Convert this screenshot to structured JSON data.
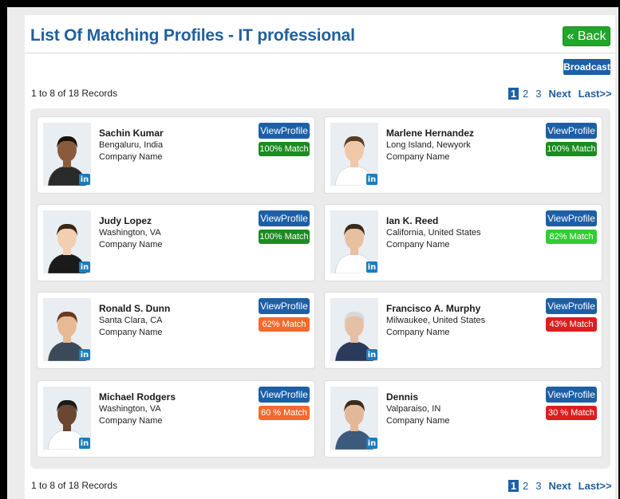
{
  "header": {
    "title": "List Of Matching Profiles - IT professional",
    "back_label": "« Back",
    "broadcast_label": "Broadcast"
  },
  "records_text": "1 to 8 of 18 Records",
  "pagination": {
    "pages": [
      "1",
      "2",
      "3"
    ],
    "next": "Next",
    "last": "Last>>"
  },
  "linkedin_badge": "in",
  "colors": {
    "green_dark": "#1e8a23",
    "green_light": "#33cc33",
    "orange": "#f26a2e",
    "red": "#d91f1f",
    "blue": "#1c5fa6"
  },
  "profiles": [
    {
      "name": "Sachin Kumar",
      "location": "Bengaluru, India",
      "company": "Company Name",
      "view_label": "ViewProfile",
      "match": "100% Match",
      "match_color": "#1e8a23"
    },
    {
      "name": "Marlene Hernandez",
      "location": "Long Island, Newyork",
      "company": "Company Name",
      "view_label": "ViewProfile",
      "match": "100% Match",
      "match_color": "#1e8a23"
    },
    {
      "name": "Judy Lopez",
      "location": "Washington, VA",
      "company": "Company Name",
      "view_label": "ViewProfile",
      "match": "100% Match",
      "match_color": "#1e8a23"
    },
    {
      "name": "Ian K. Reed",
      "location": "California, United States",
      "company": "Company Name",
      "view_label": "ViewProfile",
      "match": "82% Match",
      "match_color": "#33cc33"
    },
    {
      "name": "Ronald S. Dunn",
      "location": "Santa Clara, CA",
      "company": "Company Name",
      "view_label": "ViewProfile",
      "match": "62% Match",
      "match_color": "#f26a2e"
    },
    {
      "name": "Francisco A. Murphy",
      "location": "Milwaukee, United States",
      "company": "Company Name",
      "view_label": "ViewProfile",
      "match": "43% Match",
      "match_color": "#d91f1f"
    },
    {
      "name": "Michael Rodgers",
      "location": "Washington, VA",
      "company": "Company Name",
      "view_label": "ViewProfile",
      "match": "60 % Match",
      "match_color": "#f26a2e"
    },
    {
      "name": "Dennis",
      "location": "Valparaiso, IN",
      "company": "Company Name",
      "view_label": "ViewProfile",
      "match": "30 % Match",
      "match_color": "#d91f1f"
    }
  ]
}
